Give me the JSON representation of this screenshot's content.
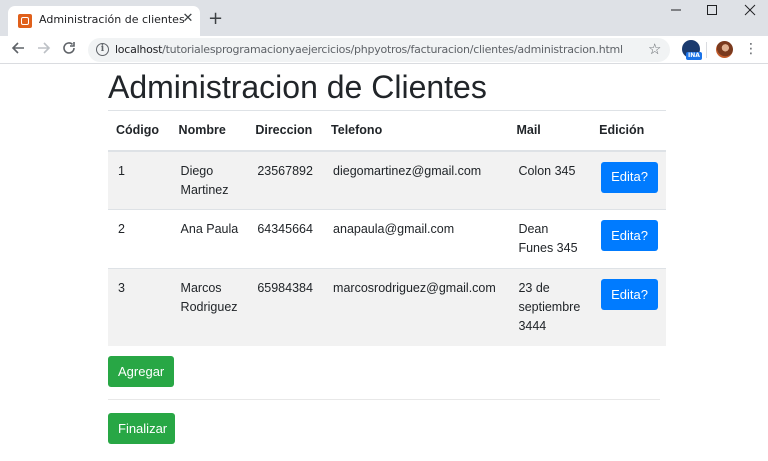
{
  "browser": {
    "tab_title": "Administración de clientes",
    "tab_close": "✕",
    "new_tab": "+",
    "url_host": "localhost",
    "url_path": "/tutorialesprogramacionyaejercicios/phpyotros/facturacion/clientes/administracion.html",
    "ext_badge": "INA"
  },
  "page": {
    "title": "Administracion de Clientes",
    "columns": [
      "Código",
      "Nombre",
      "Direccion",
      "Telefono",
      "Mail",
      "Edición"
    ],
    "rows": [
      {
        "codigo": "1",
        "nombre": "Diego Martinez",
        "direccion": "23567892",
        "telefono": "diegomartinez@gmail.com",
        "mail": "Colon 345",
        "action": "Edita?"
      },
      {
        "codigo": "2",
        "nombre": "Ana Paula",
        "direccion": "64345664",
        "telefono": "anapaula@gmail.com",
        "mail": "Dean Funes 345",
        "action": "Edita?"
      },
      {
        "codigo": "3",
        "nombre": "Marcos Rodriguez",
        "direccion": "65984384",
        "telefono": "marcosrodriguez@gmail.com",
        "mail": "23 de septiembre 3444",
        "action": "Edita?"
      }
    ],
    "add_label": "Agregar",
    "finish_label": "Finalizar"
  },
  "colors": {
    "primary": "#007bff",
    "success": "#28a745",
    "stripe": "#f2f2f2"
  }
}
